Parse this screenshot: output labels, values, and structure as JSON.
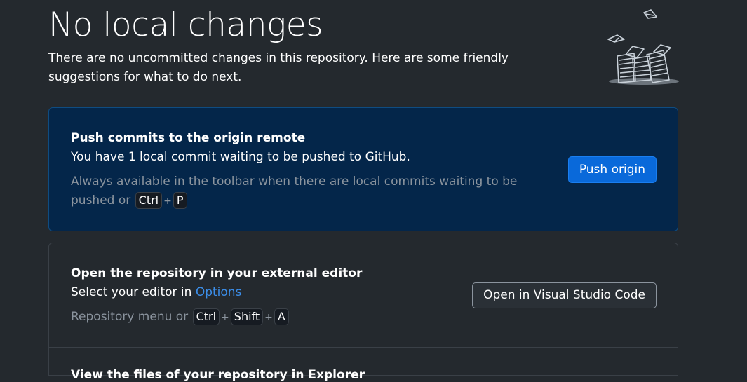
{
  "header": {
    "title": "No local changes",
    "description": "There are no uncommitted changes in this repository. Here are some friendly suggestions for what to do next."
  },
  "push_card": {
    "title": "Push commits to the origin remote",
    "description": "You have 1 local commit waiting to be pushed to GitHub.",
    "hint_prefix": "Always available in the toolbar when there are local commits waiting to be pushed or",
    "shortcut_keys": [
      "Ctrl",
      "P"
    ],
    "button_label": "Push origin"
  },
  "editor_card": {
    "title": "Open the repository in your external editor",
    "description_prefix": "Select your editor in",
    "options_link": "Options",
    "hint_prefix": "Repository menu or",
    "shortcut_keys": [
      "Ctrl",
      "Shift",
      "A"
    ],
    "button_label": "Open in Visual Studio Code"
  },
  "explorer_card": {
    "title": "View the files of your repository in Explorer"
  },
  "colors": {
    "background": "#24292e",
    "push_card_bg": "#04264a",
    "primary_button": "#0969da",
    "link": "#3b8eea",
    "muted_text": "#8b949e"
  }
}
